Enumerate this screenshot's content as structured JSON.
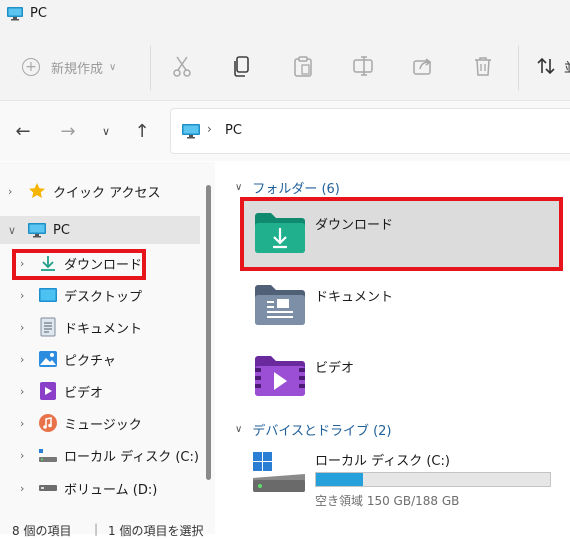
{
  "window": {
    "title": "PC"
  },
  "toolbar": {
    "new_label": "新規作成",
    "sort_label": "並"
  },
  "address": {
    "crumb": "PC"
  },
  "sidebar": {
    "items": [
      {
        "label": "クイック アクセス",
        "icon": "star-icon"
      },
      {
        "label": "PC",
        "icon": "pc-icon"
      },
      {
        "label": "ダウンロード",
        "icon": "download-icon"
      },
      {
        "label": "デスクトップ",
        "icon": "desktop-icon"
      },
      {
        "label": "ドキュメント",
        "icon": "document-icon"
      },
      {
        "label": "ピクチャ",
        "icon": "picture-icon"
      },
      {
        "label": "ビデオ",
        "icon": "video-icon"
      },
      {
        "label": "ミュージック",
        "icon": "music-icon"
      },
      {
        "label": "ローカル ディスク (C:)",
        "icon": "disk-icon"
      },
      {
        "label": "ボリューム (D:)",
        "icon": "volume-icon"
      }
    ]
  },
  "folders": {
    "header": "フォルダー (6)",
    "items": [
      {
        "label": "ダウンロード"
      },
      {
        "label": "ドキュメント"
      },
      {
        "label": "ビデオ"
      }
    ]
  },
  "devices": {
    "header": "デバイスとドライブ (2)",
    "drive": {
      "label": "ローカル ディスク (C:)",
      "space": "空き領域 150 GB/188 GB",
      "used_fraction": 0.2
    }
  },
  "status": {
    "count": "8 個の項目",
    "selected": "1 個の項目を選択"
  },
  "colors": {
    "accent": "#26a0da",
    "highlight": "#e8141b",
    "selected_bg": "#dcdcdc"
  }
}
